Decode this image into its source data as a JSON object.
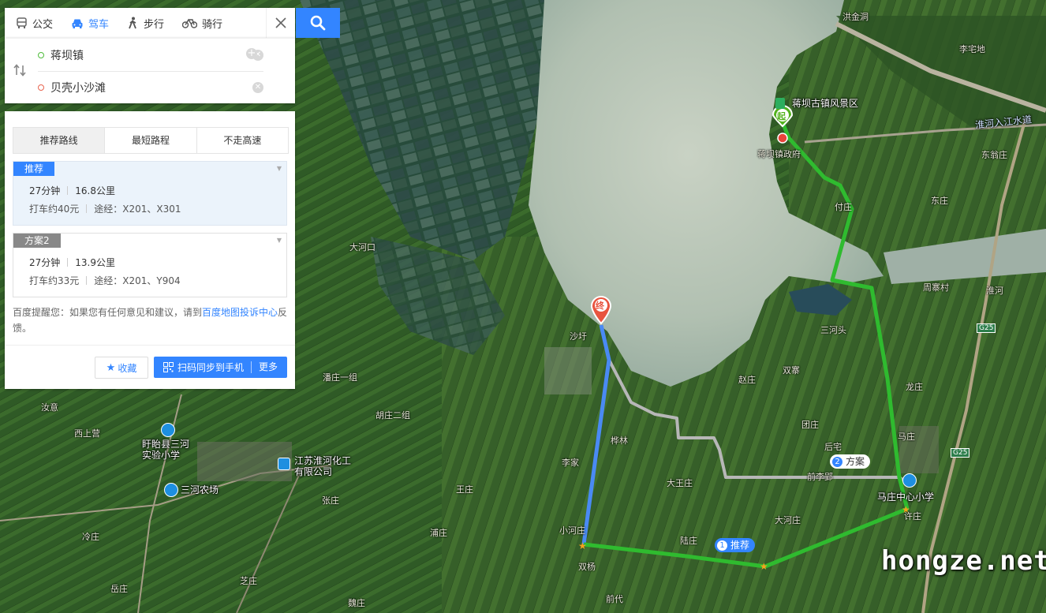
{
  "modes": [
    {
      "label": "公交",
      "icon": "bus-icon"
    },
    {
      "label": "驾车",
      "icon": "car-icon",
      "active": true
    },
    {
      "label": "步行",
      "icon": "walk-icon"
    },
    {
      "label": "骑行",
      "icon": "bike-icon"
    }
  ],
  "route": {
    "start": "蒋坝镇",
    "end": "贝壳小沙滩"
  },
  "tabs": [
    "推荐路线",
    "最短路程",
    "不走高速"
  ],
  "plans": [
    {
      "tag": "推荐",
      "time": "27分钟",
      "distance": "16.8公里",
      "taxi": "打车约40元",
      "via": "途经：X201、X301"
    },
    {
      "tag": "方案2",
      "time": "27分钟",
      "distance": "13.9公里",
      "taxi": "打车约33元",
      "via": "途经：X201、Y904"
    }
  ],
  "notice": {
    "prefix": "百度提醒您：如果您有任何意见和建议，请到",
    "link": "百度地图投诉中心",
    "suffix": "反馈。"
  },
  "actions": {
    "favorite": "收藏",
    "share": "扫码同步到手机",
    "more": "更多"
  },
  "map": {
    "labels": {
      "scenic": "蒋坝古镇风景区",
      "start_pin": "起",
      "end_pin": "终",
      "gov": "蒋坝镇政府",
      "school_mz": "马庄中心小学",
      "school_sh": "盱眙县三河实验小学",
      "farm": "三河农场",
      "chem": "江苏淮河化工有限公司",
      "rec_tag": "推荐",
      "rec_no": "1",
      "alt_tag": "方案",
      "alt_no": "2",
      "hongze": "洪金洞",
      "river": "淮河入江水道",
      "dongli": "大河口",
      "shaxu": "沙圩",
      "xiaohezhuang": "小河庄",
      "shuangyang": "双杨",
      "hualin": "桦林",
      "lizhuang": "李家",
      "dawang": "大王庄",
      "qianli": "前李郢",
      "houzhai": "后宅",
      "dihe": "大河庄",
      "lu": "陆庄",
      "xuzhuang": "许庄",
      "mazhuang": "马庄",
      "tuanzhuang": "团庄",
      "sanhe": "三河头",
      "zhouzhai": "周寨村",
      "longzhuang": "龙庄",
      "shuangzhai": "双寨",
      "qiandai": "前代",
      "zhuang2": "赵庄",
      "fuzhuang": "付庄",
      "wangzhuang": "王庄",
      "leng": "冷庄",
      "yue": "岳庄",
      "zhai": "张庄",
      "lizhaidi": "李宅地",
      "dongweng": "东翁庄",
      "huaihe": "淮河",
      "dongzhuang": "东庄",
      "puzhuang": "浦庄",
      "g25": "G25",
      "zhi": "芝庄",
      "qian": "潘庄一组",
      "hu": "胡庄二组",
      "weizhuang": "魏庄",
      "ruyi": "汝意",
      "xishang": "西上营"
    }
  }
}
